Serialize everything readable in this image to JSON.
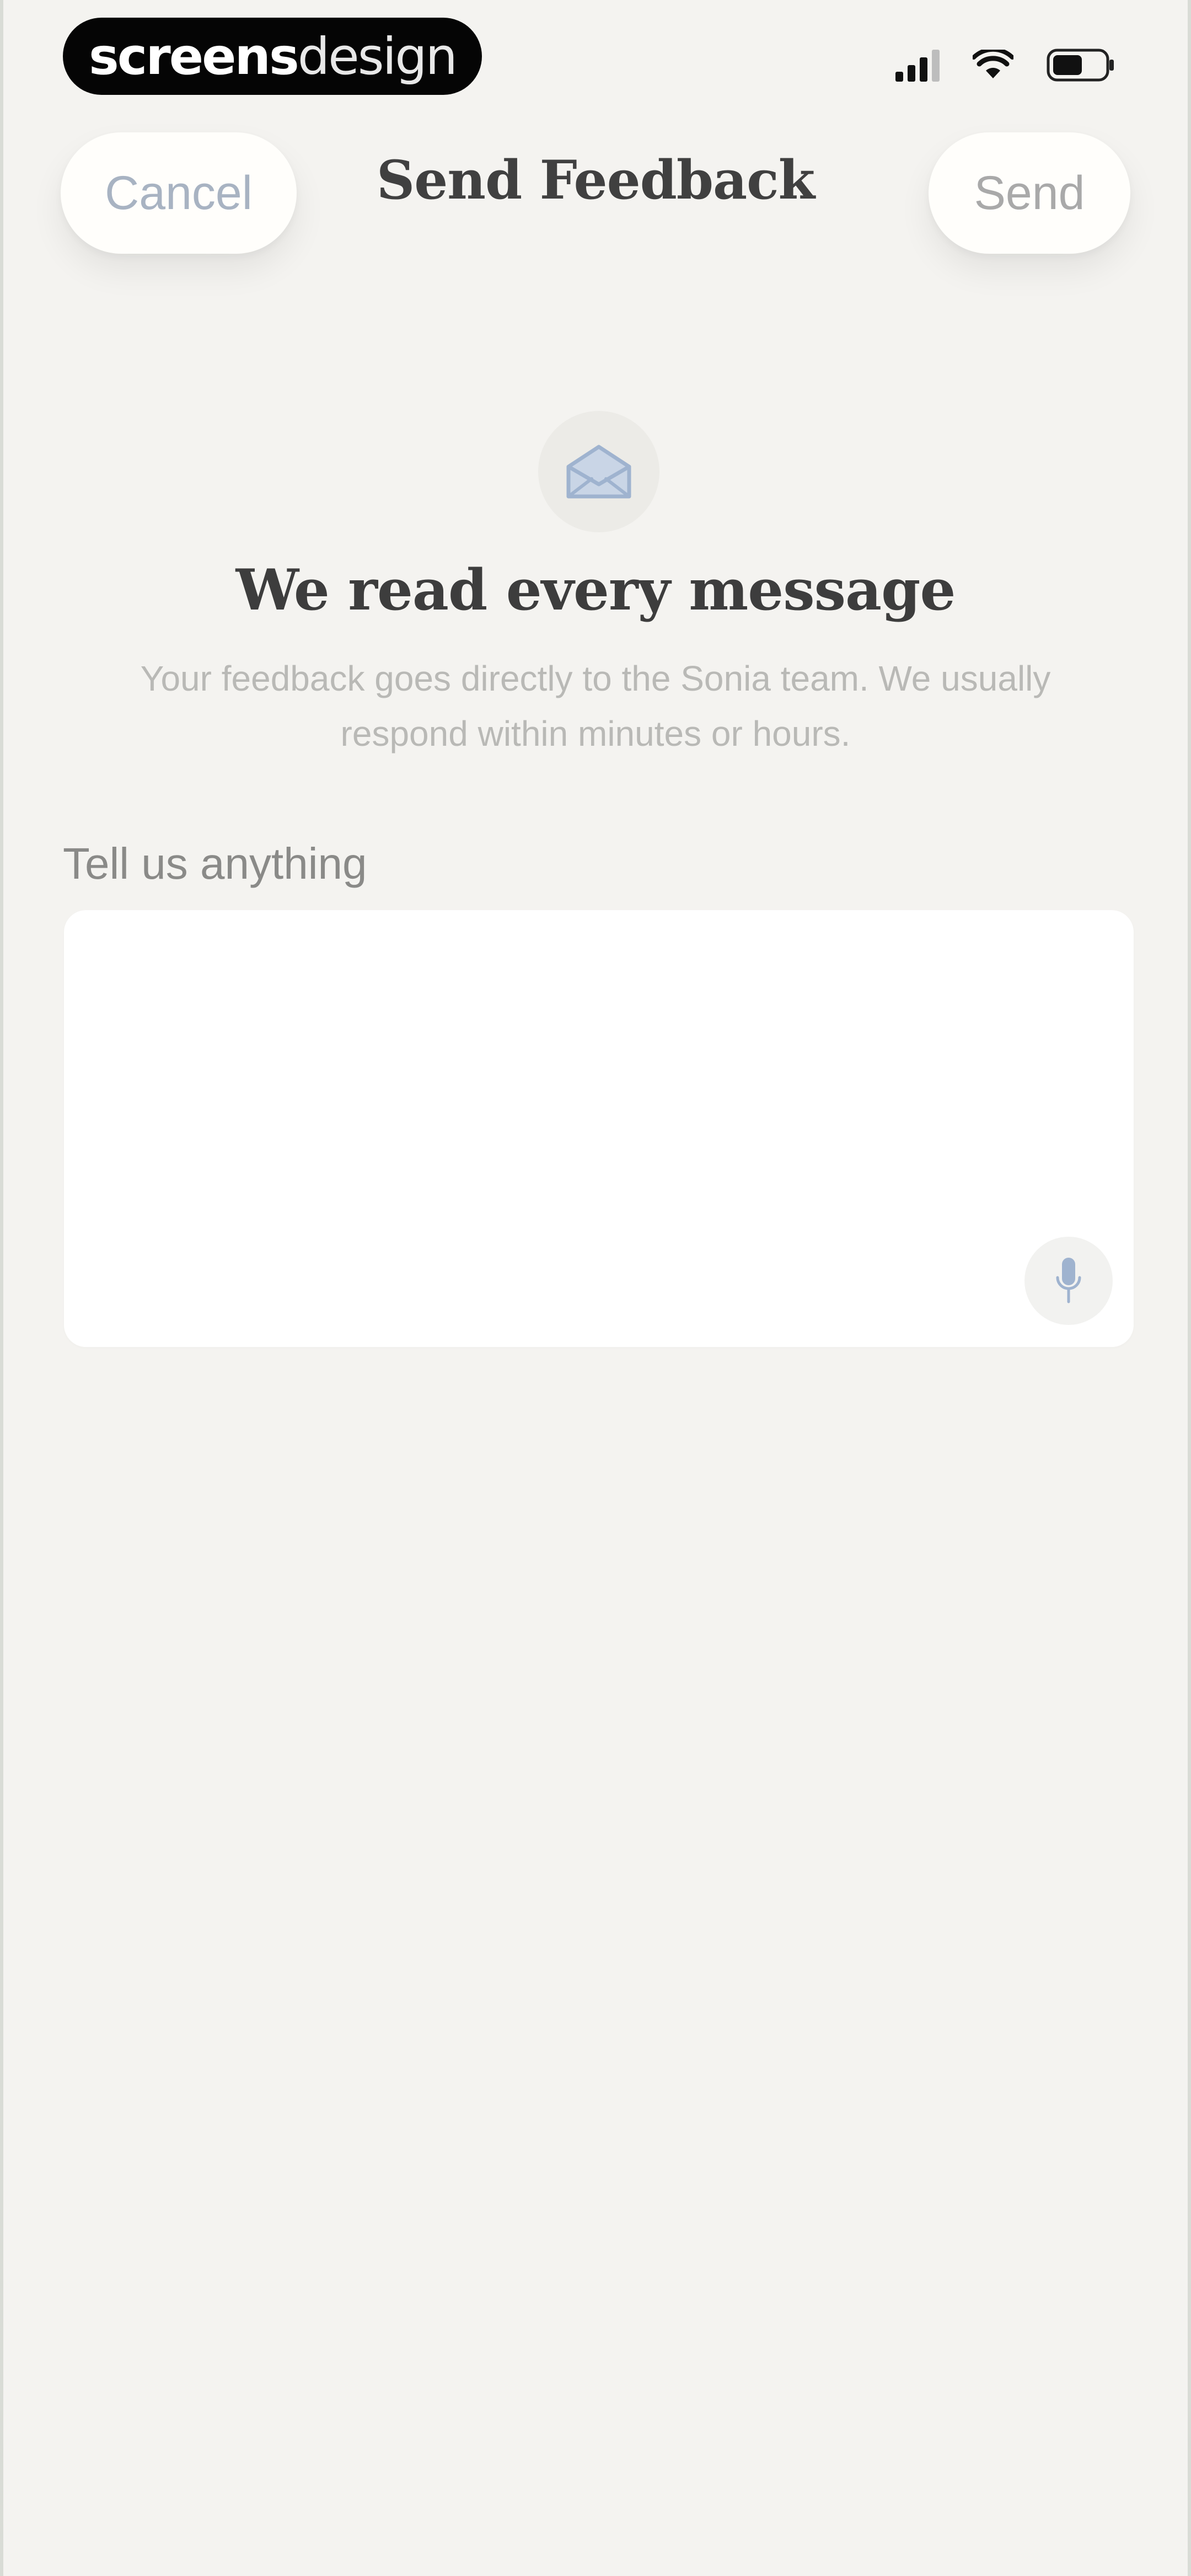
{
  "status_bar": {
    "brand_bold": "screens",
    "brand_light": "design",
    "icons": [
      "signal-icon",
      "wifi-icon",
      "battery-icon"
    ]
  },
  "header": {
    "cancel_label": "Cancel",
    "title": "Send Feedback",
    "send_label": "Send"
  },
  "hero": {
    "icon": "envelope-icon",
    "title": "We read every message",
    "subtitle": "Your feedback goes directly to the Sonia team. We usually respond within minutes or hours."
  },
  "form": {
    "label": "Tell us anything",
    "value": "",
    "mic_icon": "microphone-icon"
  },
  "colors": {
    "background": "#f4f3f0",
    "card": "#ffffff",
    "accent_muted": "#a8b3c2",
    "icon_blue": "#9fb3cf"
  }
}
